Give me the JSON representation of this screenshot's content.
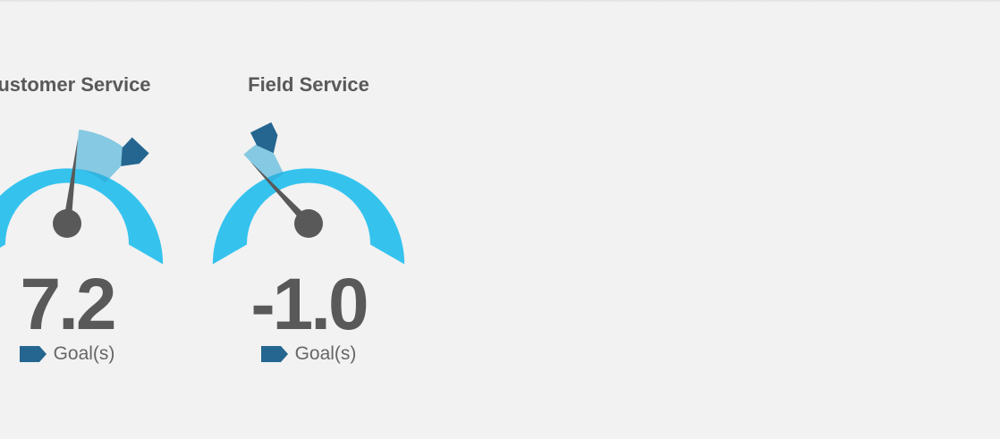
{
  "colors": {
    "background": "#f2f2f2",
    "gauge_fill": "#35c3ee",
    "gauge_shade": "#2ea8d6",
    "goal_marker": "#256690",
    "needle": "#595959",
    "text": "#595959"
  },
  "gauges": [
    {
      "title": "Customer Service",
      "value": "7.2",
      "legend": "Goal(s)",
      "needle_level": 0.53,
      "goal_level": 0.68
    },
    {
      "title": "Field Service",
      "value": "-1.0",
      "legend": "Goal(s)",
      "needle_level": 0.32,
      "goal_level": 0.39
    }
  ]
}
